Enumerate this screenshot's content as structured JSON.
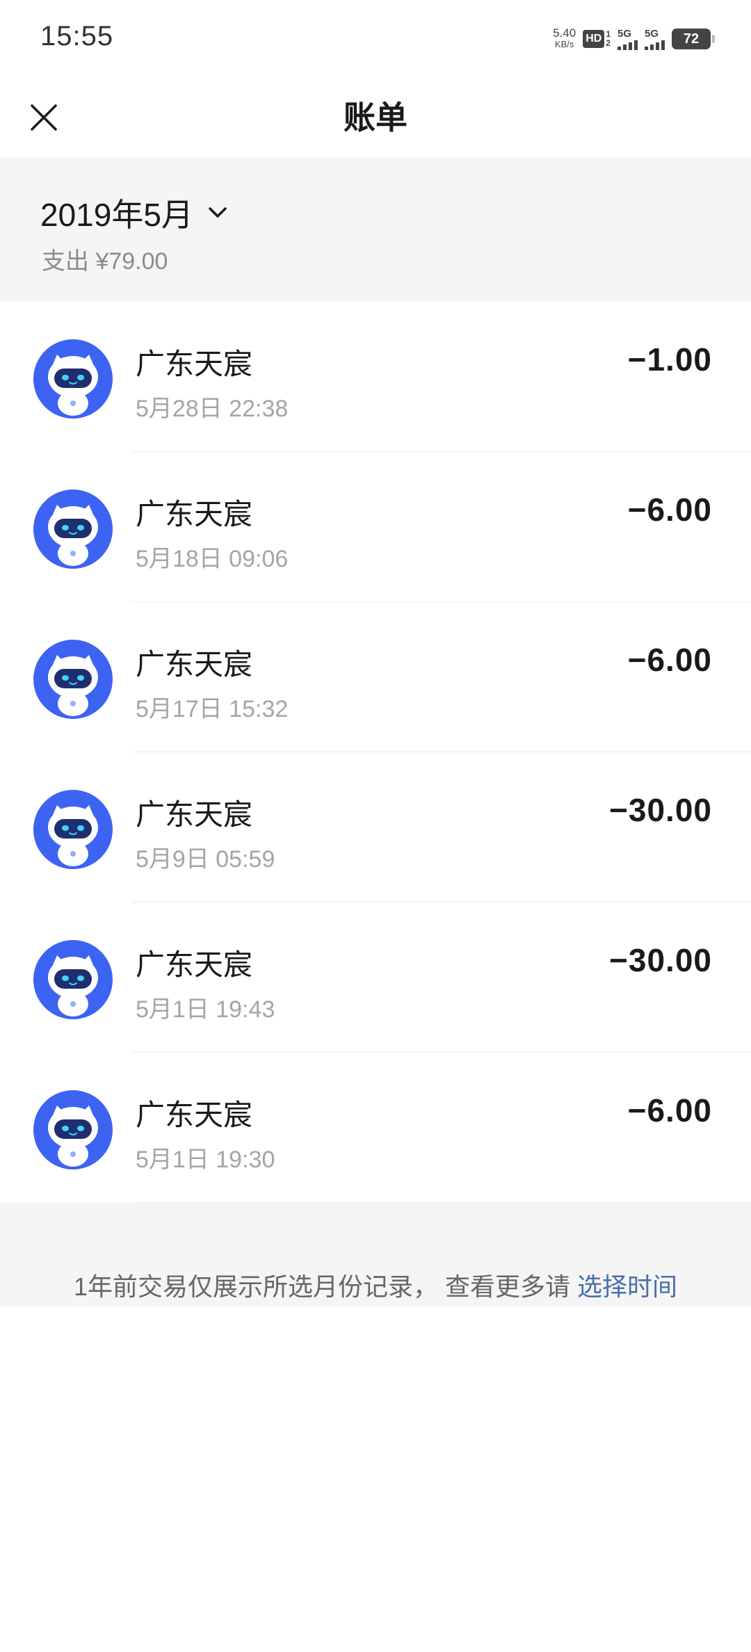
{
  "status_bar": {
    "time": "15:55",
    "net_speed_value": "5.40",
    "net_speed_unit": "KB/s",
    "hd_label": "HD",
    "hd_sub_top": "1",
    "hd_sub_bottom": "2",
    "signal1_label": "5G",
    "signal2_label": "5G",
    "battery": "72"
  },
  "header": {
    "title": "账单"
  },
  "month": {
    "label": "2019年5月",
    "summary": "支出 ¥79.00"
  },
  "transactions": [
    {
      "name": "广东天宸",
      "time": "5月28日 22:38",
      "amount": "−1.00"
    },
    {
      "name": "广东天宸",
      "time": "5月18日 09:06",
      "amount": "−6.00"
    },
    {
      "name": "广东天宸",
      "time": "5月17日 15:32",
      "amount": "−6.00"
    },
    {
      "name": "广东天宸",
      "time": "5月9日 05:59",
      "amount": "−30.00"
    },
    {
      "name": "广东天宸",
      "time": "5月1日 19:43",
      "amount": "−30.00"
    },
    {
      "name": "广东天宸",
      "time": "5月1日 19:30",
      "amount": "−6.00"
    }
  ],
  "footer": {
    "note": "1年前交易仅展示所选月份记录， 查看更多请 ",
    "link": "选择时间"
  },
  "colors": {
    "avatar_blue": "#3d63f2",
    "link_blue": "#4a6ea8",
    "section_gray": "#f5f5f5"
  },
  "icons": [
    "close-icon",
    "chevron-down-icon",
    "robot-avatar-icon"
  ]
}
